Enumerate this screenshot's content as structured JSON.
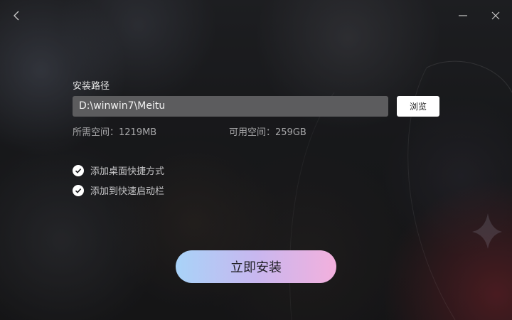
{
  "window": {
    "back_icon": "chevron-left-icon",
    "minimize_icon": "minimize-icon",
    "close_icon": "close-icon"
  },
  "install_path": {
    "label": "安装路径",
    "value": "D:\\winwin7\\Meitu",
    "browse_label": "浏览"
  },
  "space": {
    "required": "所需空间：1219MB",
    "available": "可用空间：259GB"
  },
  "options": [
    {
      "label": "添加桌面快捷方式",
      "checked": true
    },
    {
      "label": "添加到快速启动栏",
      "checked": true
    }
  ],
  "install_button": {
    "label": "立即安装"
  },
  "colors": {
    "background": "#1a1b1e",
    "input_bg": "#5c5c5e",
    "gradient_start": "#a8d3f8",
    "gradient_mid": "#c8b7ef",
    "gradient_end": "#f3b0dd"
  }
}
